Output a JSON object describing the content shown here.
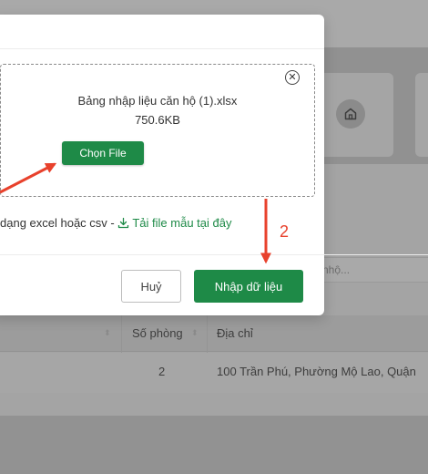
{
  "background": {
    "search_placeholder": "nhộ...",
    "table": {
      "headers": [
        "Số phòng",
        "Địa chỉ"
      ],
      "rows": [
        {
          "room": "2",
          "address": "100 Trần Phú, Phường Mộ Lao, Quận"
        }
      ]
    }
  },
  "modal": {
    "file": {
      "name": "Bảng nhập liệu căn hộ (1).xlsx",
      "size": "750.6KB"
    },
    "choose_file_label": "Chọn File",
    "hint_text": "dạng excel hoặc csv -",
    "template_link_label": "Tải file mẫu tại đây",
    "cancel_label": "Huỷ",
    "import_label": "Nhập dữ liệu"
  },
  "annotations": {
    "step_number": "2",
    "arrow_color": "#e8412c"
  },
  "colors": {
    "primary": "#1e8a47",
    "overlay": "#8e8e8e"
  }
}
